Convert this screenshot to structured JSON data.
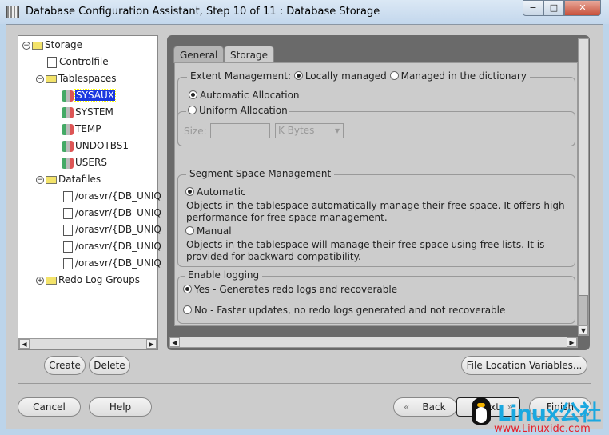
{
  "window": {
    "title": "Database Configuration Assistant, Step 10 of 11 : Database Storage",
    "minimize": "−",
    "maximize": "□",
    "close": "✕"
  },
  "tree": {
    "root": "Storage",
    "controlfile": "Controlfile",
    "tablespaces": "Tablespaces",
    "tablespace_items": [
      "SYSAUX",
      "SYSTEM",
      "TEMP",
      "UNDOTBS1",
      "USERS"
    ],
    "selected": "SYSAUX",
    "datafiles": "Datafiles",
    "datafile_items": [
      "/orasvr/{DB_UNIQ",
      "/orasvr/{DB_UNIQ",
      "/orasvr/{DB_UNIQ",
      "/orasvr/{DB_UNIQ",
      "/orasvr/{DB_UNIQ"
    ],
    "redo": "Redo Log Groups"
  },
  "tabs": [
    "General",
    "Storage"
  ],
  "active_tab": "Storage",
  "extent": {
    "label": "Extent Management:",
    "local": "Locally managed",
    "dictionary": "Managed in the dictionary",
    "auto": "Automatic Allocation",
    "uniform": "Uniform Allocation",
    "size_label": "Size:",
    "size_value": "",
    "unit": "K Bytes"
  },
  "segment": {
    "legend": "Segment Space Management",
    "automatic": "Automatic",
    "automatic_desc1": "Objects in the tablespace automatically manage their free space. It offers high",
    "automatic_desc2": "performance for free space management.",
    "manual": "Manual",
    "manual_desc1": "Objects in the tablespace will manage their free space using free lists. It is",
    "manual_desc2": "provided for backward compatibility."
  },
  "logging": {
    "legend": "Enable logging",
    "yes": "Yes - Generates redo logs and recoverable",
    "no": "No - Faster updates, no redo logs generated and not recoverable"
  },
  "buttons": {
    "create": "Create",
    "delete": "Delete",
    "file_location": "File Location Variables...",
    "cancel": "Cancel",
    "help": "Help",
    "back": "Back",
    "next": "Next",
    "finish": "Finish"
  },
  "watermark": {
    "brand": "Linux公社",
    "url": "www.Linuxidc.com"
  }
}
